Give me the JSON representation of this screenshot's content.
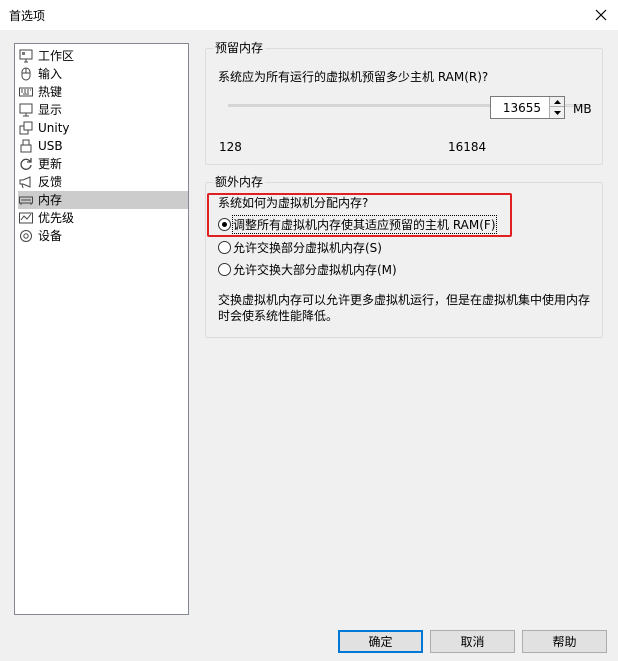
{
  "window": {
    "title": "首选项"
  },
  "nav": {
    "items": [
      {
        "label": "工作区",
        "icon": "workspace-icon"
      },
      {
        "label": "输入",
        "icon": "mouse-icon"
      },
      {
        "label": "热键",
        "icon": "keyboard-icon"
      },
      {
        "label": "显示",
        "icon": "monitor-icon"
      },
      {
        "label": "Unity",
        "icon": "unity-icon"
      },
      {
        "label": "USB",
        "icon": "usb-icon"
      },
      {
        "label": "更新",
        "icon": "refresh-icon"
      },
      {
        "label": "反馈",
        "icon": "megaphone-icon"
      },
      {
        "label": "内存",
        "icon": "memory-icon",
        "selected": true
      },
      {
        "label": "优先级",
        "icon": "priority-icon"
      },
      {
        "label": "设备",
        "icon": "device-icon"
      }
    ]
  },
  "reserved": {
    "group_title": "预留内存",
    "question": "系统应为所有运行的虚拟机预留多少主机 RAM(R)?",
    "slider_min_label": "128",
    "slider_max_label": "16184",
    "value": "13655",
    "unit": "MB",
    "slider_level": 0.84
  },
  "extra": {
    "group_title": "额外内存",
    "question": "系统如何为虚拟机分配内存?",
    "options": [
      {
        "label": "调整所有虚拟机内存使其适应预留的主机 RAM(F)",
        "checked": true
      },
      {
        "label": "允许交换部分虚拟机内存(S)",
        "checked": false
      },
      {
        "label": "允许交换大部分虚拟机内存(M)",
        "checked": false
      }
    ],
    "description": "交换虚拟机内存可以允许更多虚拟机运行，但是在虚拟机集中使用内存时会使系统性能降低。"
  },
  "buttons": {
    "ok": "确定",
    "cancel": "取消",
    "help": "帮助"
  },
  "colors": {
    "highlight": "#e02020",
    "accent": "#0078d7",
    "selection": "#cccccc"
  }
}
